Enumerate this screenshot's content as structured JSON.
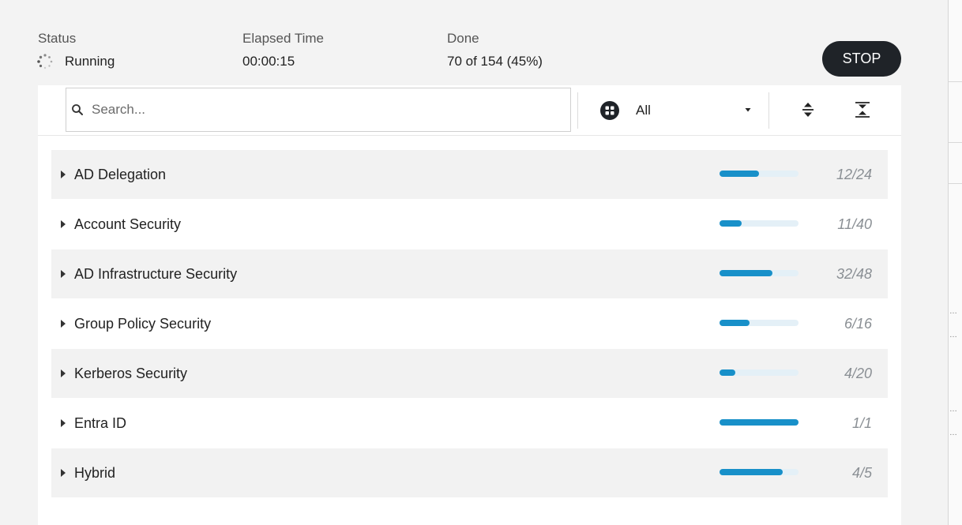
{
  "status": {
    "status_label": "Status",
    "status_value": "Running",
    "elapsed_label": "Elapsed Time",
    "elapsed_value": "00:00:15",
    "done_label": "Done",
    "done_value": "70 of 154 (45%)",
    "stop_label": "STOP"
  },
  "toolbar": {
    "search_placeholder": "Search...",
    "filter_value": "All",
    "icons": [
      "search-icon",
      "category-filter-icon",
      "dropdown-caret-icon",
      "expand-all-icon",
      "collapse-all-icon"
    ]
  },
  "categories": [
    {
      "label": "AD Delegation",
      "count": "12/24",
      "progress": 0.5
    },
    {
      "label": "Account Security",
      "count": "11/40",
      "progress": 0.275
    },
    {
      "label": "AD Infrastructure Security",
      "count": "32/48",
      "progress": 0.667
    },
    {
      "label": "Group Policy Security",
      "count": "6/16",
      "progress": 0.375
    },
    {
      "label": "Kerberos Security",
      "count": "4/20",
      "progress": 0.2
    },
    {
      "label": "Entra ID",
      "count": "1/1",
      "progress": 1.0
    },
    {
      "label": "Hybrid",
      "count": "4/5",
      "progress": 0.8
    }
  ],
  "colors": {
    "accent": "#1890c9",
    "track": "#e4f0f7",
    "stop_button": "#1f2328"
  }
}
